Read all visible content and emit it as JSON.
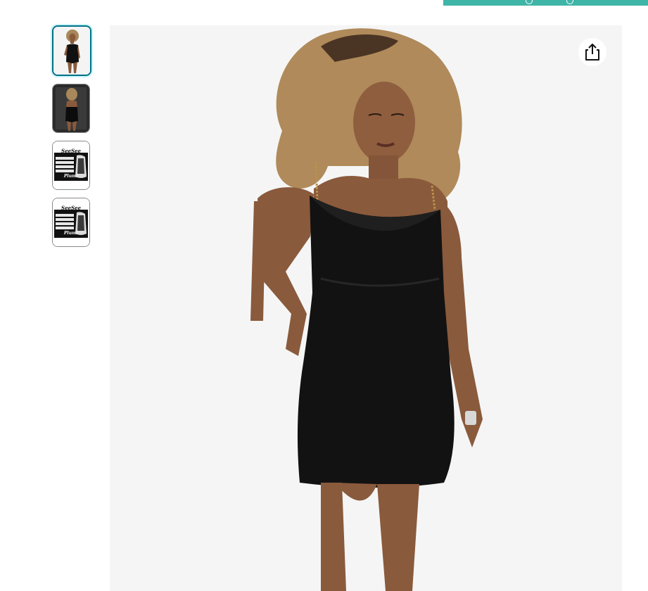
{
  "top_strip": {
    "color": "#3fb5a8"
  },
  "thumbnails": [
    {
      "name": "thumbnail-1",
      "selected": true,
      "kind": "model-front-photo"
    },
    {
      "name": "thumbnail-2",
      "selected": false,
      "kind": "model-back-photo"
    },
    {
      "name": "thumbnail-3",
      "selected": false,
      "kind": "size-chart-graphic",
      "script_text": "SeeSee",
      "badge_text": "Plum!"
    },
    {
      "name": "thumbnail-4",
      "selected": false,
      "kind": "size-chart-graphic",
      "script_text": "SeeSee",
      "badge_text": "Plum!"
    }
  ],
  "main_image": {
    "subject": "Model wearing black cowl-neck chain-strap mini dress",
    "background_color": "#f5f5f5"
  },
  "share_button": {
    "icon": "share-icon"
  },
  "colors": {
    "selected_border": "#007185",
    "dress": "#111111",
    "skin": "#8a5a3c",
    "hair": "#b08a5a"
  }
}
